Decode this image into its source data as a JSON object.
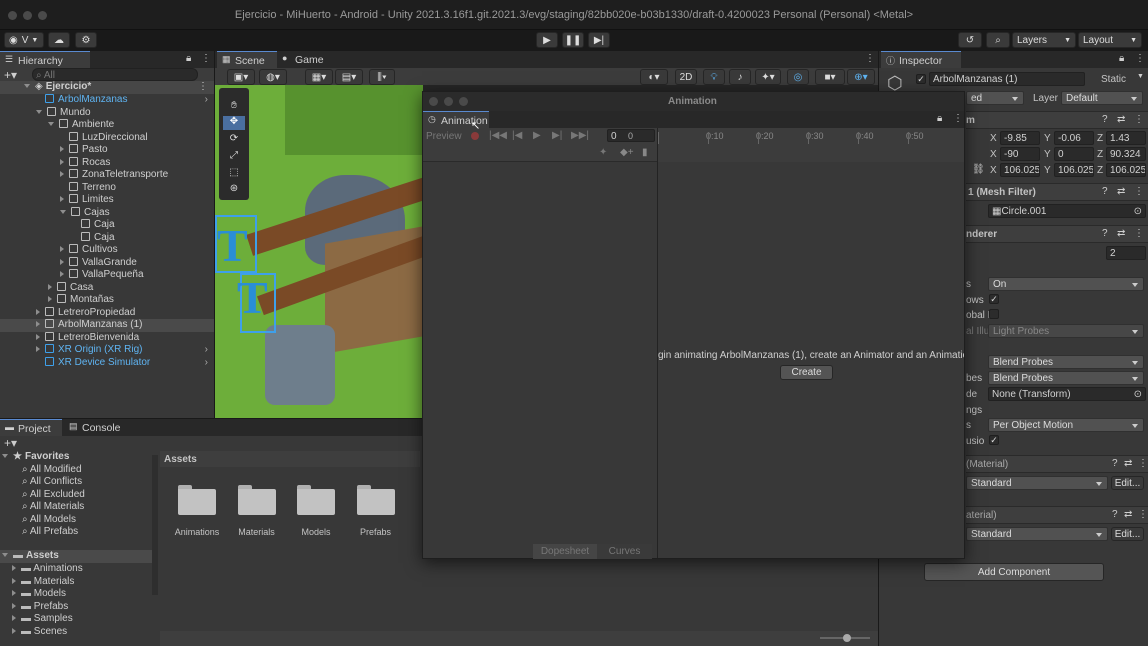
{
  "window": {
    "title": "Ejercicio - MiHuerto - Android - Unity 2021.3.16f1.git.2021.3/evg/staging/82bb020e-b03b1330/draft-0.4200023 Personal (Personal) <Metal>"
  },
  "toolbar": {
    "account_label": "V",
    "layers_label": "Layers",
    "layout_label": "Layout"
  },
  "hierarchy": {
    "tab_label": "Hierarchy",
    "search_placeholder": "All",
    "scene_name": "Ejercicio*",
    "items": [
      {
        "label": "ArbolManzanas",
        "level": 1,
        "blue": true,
        "arrow": "none"
      },
      {
        "label": "Mundo",
        "level": 1,
        "blue": false,
        "arrow": "down"
      },
      {
        "label": "Ambiente",
        "level": 2,
        "blue": false,
        "arrow": "down"
      },
      {
        "label": "LuzDireccional",
        "level": 3,
        "blue": false,
        "arrow": "none"
      },
      {
        "label": "Pasto",
        "level": 3,
        "blue": false,
        "arrow": "right"
      },
      {
        "label": "Rocas",
        "level": 3,
        "blue": false,
        "arrow": "right"
      },
      {
        "label": "ZonaTeletransporte",
        "level": 3,
        "blue": false,
        "arrow": "right"
      },
      {
        "label": "Terreno",
        "level": 3,
        "blue": false,
        "arrow": "none"
      },
      {
        "label": "Limites",
        "level": 3,
        "blue": false,
        "arrow": "right"
      },
      {
        "label": "Cajas",
        "level": 3,
        "blue": false,
        "arrow": "down"
      },
      {
        "label": "Caja",
        "level": 4,
        "blue": false,
        "arrow": "none"
      },
      {
        "label": "Caja",
        "level": 4,
        "blue": false,
        "arrow": "none"
      },
      {
        "label": "Cultivos",
        "level": 3,
        "blue": false,
        "arrow": "right"
      },
      {
        "label": "VallaGrande",
        "level": 3,
        "blue": false,
        "arrow": "right"
      },
      {
        "label": "VallaPequeña",
        "level": 3,
        "blue": false,
        "arrow": "right"
      },
      {
        "label": "Casa",
        "level": 2,
        "blue": false,
        "arrow": "right"
      },
      {
        "label": "Montañas",
        "level": 2,
        "blue": false,
        "arrow": "right"
      },
      {
        "label": "LetreroPropiedad",
        "level": 1,
        "blue": false,
        "arrow": "right"
      },
      {
        "label": "ArbolManzanas (1)",
        "level": 1,
        "blue": false,
        "arrow": "right",
        "selected": true
      },
      {
        "label": "LetreroBienvenida",
        "level": 1,
        "blue": false,
        "arrow": "right"
      },
      {
        "label": "XR Origin (XR Rig)",
        "level": 1,
        "blue": true,
        "arrow": "right"
      },
      {
        "label": "XR Device Simulator",
        "level": 1,
        "blue": true,
        "arrow": "none"
      }
    ]
  },
  "scene": {
    "tab_scene": "Scene",
    "tab_game": "Game",
    "btn_2d": "2D"
  },
  "animation": {
    "window_title": "Animation",
    "tab_label": "Animation",
    "preview_label": "Preview",
    "ticks": [
      "0",
      "0:10",
      "0:20",
      "0:30",
      "0:40",
      "0:50"
    ],
    "message": "gin animating ArbolManzanas (1), create an Animator and an Animatio",
    "create_button": "Create",
    "dopesheet_tab": "Dopesheet",
    "curves_tab": "Curves"
  },
  "inspector": {
    "tab_label": "Inspector",
    "object_name": "ArbolManzanas (1)",
    "static_label": "Static",
    "tag_value": "ed",
    "layer_label": "Layer",
    "layer_value": "Default",
    "transform_header": "m",
    "position": {
      "x": "-9.85",
      "y": "-0.06",
      "z": "1.43"
    },
    "rotation": {
      "x": "-90",
      "y": "0",
      "z": "90.324"
    },
    "scale": {
      "x": "106.025",
      "y": "106.025",
      "z": "106.025"
    },
    "mesh_filter_header": "1 (Mesh Filter)",
    "mesh_value": "Circle.001",
    "renderer_header": "nderer",
    "materials_count": "2",
    "shadows_label": "s",
    "shadows_value": "On",
    "receive_shadows_label": "ows",
    "global_illum_label": "obal I",
    "light_probes_label_cut": "al Illu",
    "light_probes_value": "Light Probes",
    "blend1_value": "Blend Probes",
    "probes_label": "bes",
    "blend2_value": "Blend Probes",
    "anchor_label": "de",
    "anchor_value": "None (Transform)",
    "settings_label": "ngs",
    "motion_label": "s",
    "motion_value": "Per Object Motion",
    "occlusion_label": "usio",
    "material1_header": "(Material)",
    "material1_shader": "Standard",
    "material2_header": "aterial)",
    "material2_shader": "Standard",
    "edit_label": "Edit...",
    "add_component": "Add Component"
  },
  "project": {
    "tab_project": "Project",
    "tab_console": "Console",
    "favorites_label": "Favorites",
    "favorites": [
      "All Modified",
      "All Conflicts",
      "All Excluded",
      "All Materials",
      "All Models",
      "All Prefabs"
    ],
    "assets_label": "Assets",
    "asset_folders": [
      "Animations",
      "Materials",
      "Models",
      "Prefabs",
      "Samples",
      "Scenes"
    ],
    "breadcrumb": "Assets",
    "grid_folders": [
      "Animations",
      "Materials",
      "Models",
      "Prefabs"
    ]
  }
}
